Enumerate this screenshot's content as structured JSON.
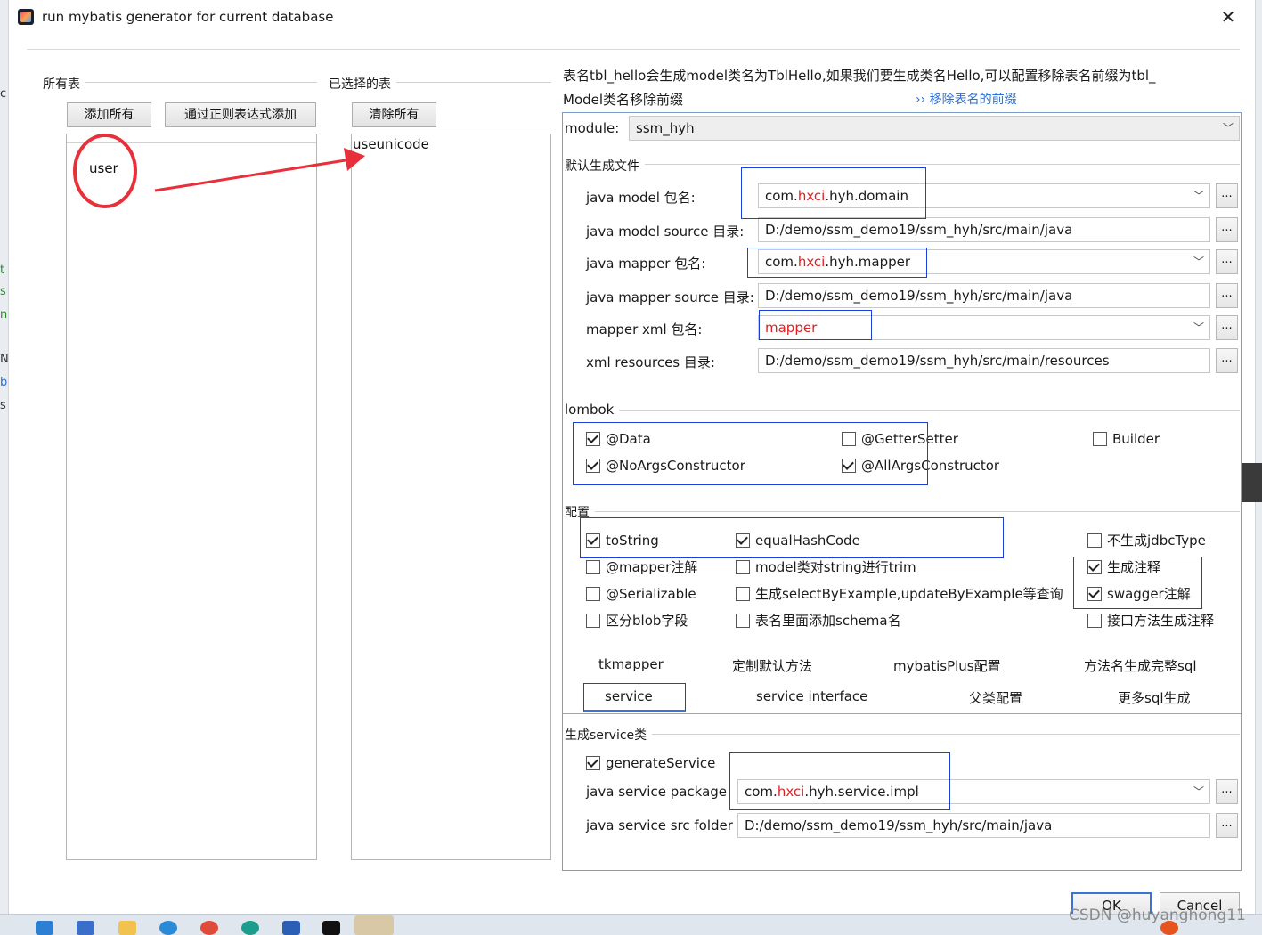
{
  "window": {
    "title": "run mybatis generator for current database",
    "close_label": "✕"
  },
  "left": {
    "all_tables_label": "所有表",
    "add_all_button": "添加所有",
    "add_regex_button": "通过正则表达式添加",
    "all_tables": [
      "user"
    ]
  },
  "middle": {
    "selected_tables_label": "已选择的表",
    "clear_all_button": "清除所有",
    "selected_tables": [
      "useunicode"
    ]
  },
  "hint": {
    "line1": "表名tbl_hello会生成model类名为TblHello,如果我们要生成类名Hello,可以配置移除表名前缀为tbl_",
    "line2": "Model类名移除前缀",
    "link": "›› 移除表名的前缀"
  },
  "module": {
    "label": "module:",
    "value": "ssm_hyh"
  },
  "default_files": {
    "section_label": "默认生成文件",
    "fields": [
      {
        "label": "java model 包名:",
        "prefix": "com.",
        "highlight": "hxci",
        "suffix": ".hyh.domain"
      },
      {
        "label": "java model source 目录:",
        "value": "D:/demo/ssm_demo19/ssm_hyh/src/main/java"
      },
      {
        "label": "java mapper 包名:",
        "prefix": "com.",
        "highlight": "hxci",
        "suffix": ".hyh.mapper"
      },
      {
        "label": "java mapper source 目录:",
        "value": "D:/demo/ssm_demo19/ssm_hyh/src/main/java"
      },
      {
        "label": "mapper xml 包名:",
        "value": "mapper"
      },
      {
        "label": "xml resources 目录:",
        "value": "D:/demo/ssm_demo19/ssm_hyh/src/main/resources"
      }
    ],
    "dots_label": "..."
  },
  "lombok": {
    "section_label": "lombok",
    "options": [
      {
        "label": "@Data",
        "checked": true
      },
      {
        "label": "@GetterSetter",
        "checked": false
      },
      {
        "label": "Builder",
        "checked": false
      },
      {
        "label": "@NoArgsConstructor",
        "checked": true
      },
      {
        "label": "@AllArgsConstructor",
        "checked": true
      }
    ]
  },
  "config": {
    "section_label": "配置",
    "options": [
      {
        "label": "toString",
        "checked": true
      },
      {
        "label": "equalHashCode",
        "checked": true
      },
      {
        "label": "不生成jdbcType",
        "checked": false
      },
      {
        "label": "@mapper注解",
        "checked": false
      },
      {
        "label": "model类对string进行trim",
        "checked": false
      },
      {
        "label": "生成注释",
        "checked": true
      },
      {
        "label": "@Serializable",
        "checked": false
      },
      {
        "label": "生成selectByExample,updateByExample等查询",
        "checked": false
      },
      {
        "label": "swagger注解",
        "checked": true
      },
      {
        "label": "区分blob字段",
        "checked": false
      },
      {
        "label": "表名里面添加schema名",
        "checked": false
      },
      {
        "label": "接口方法生成注释",
        "checked": false
      }
    ]
  },
  "tabs": {
    "row1": [
      "tkmapper",
      "定制默认方法",
      "mybatisPlus配置",
      "方法名生成完整sql"
    ],
    "row2": [
      "service",
      "service interface",
      "父类配置",
      "更多sql生成"
    ],
    "active": "service"
  },
  "service": {
    "section_label": "生成service类",
    "generate_label": "generateService",
    "generate_checked": true,
    "package_label": "java service package",
    "package_prefix": "com.",
    "package_highlight": "hxci",
    "package_suffix": ".hyh.service.impl",
    "folder_label": "java service src folder",
    "folder_value": "D:/demo/ssm_demo19/ssm_hyh/src/main/java"
  },
  "buttons": {
    "ok": "OK",
    "cancel": "Cancel"
  },
  "watermark": "CSDN @huyanghong11",
  "colors": {
    "highlight_red": "#e02020",
    "annotation_blue": "#1d3fd6",
    "annotation_red": "#e8303a",
    "link_blue": "#2a6fd6"
  }
}
